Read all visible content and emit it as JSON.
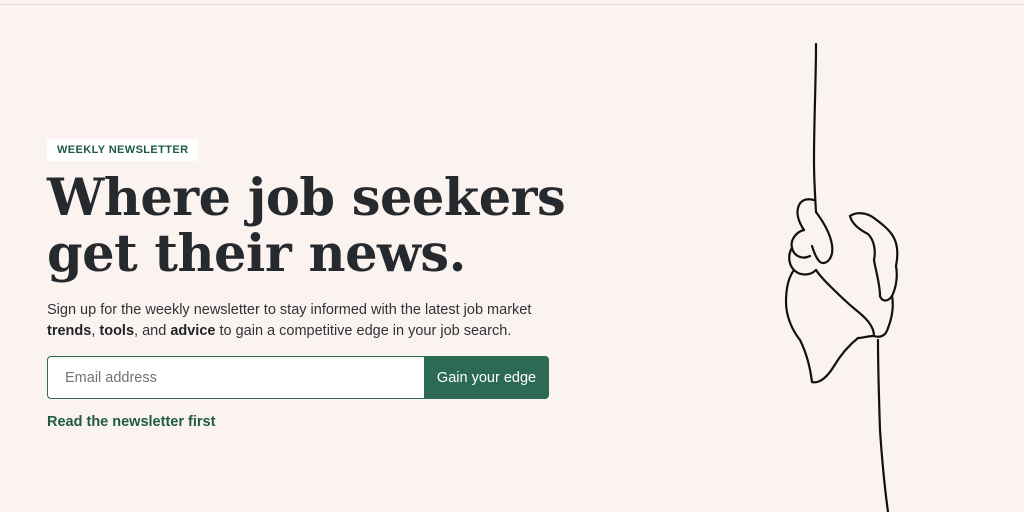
{
  "badge": "WEEKLY NEWSLETTER",
  "headline": {
    "line1": "Where job seekers",
    "line2": "get their news."
  },
  "description": {
    "intro": "Sign up for the weekly newsletter to stay informed with the latest job market",
    "word_trends": "trends",
    "sep1": ", ",
    "word_tools": "tools",
    "sep2": ", and ",
    "word_advice": "advice",
    "outro": " to gain a competitive edge in your job search."
  },
  "signup": {
    "placeholder": "Email address",
    "button_label": "Gain your edge"
  },
  "secondary_link": "Read the newsletter first",
  "illustration_icon": "helping-hands-line-art",
  "colors": {
    "background": "#fbf3f0",
    "accent": "#2c6a55",
    "headline": "#262a2e"
  }
}
